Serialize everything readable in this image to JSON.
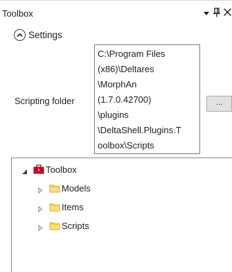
{
  "panel": {
    "title": "Toolbox"
  },
  "settings": {
    "toggle_label": "Settings",
    "scripting_folder_label": "Scripting folder",
    "scripting_folder_lines": [
      "C:\\Program Files",
      "(x86)\\Deltares",
      "\\MorphAn",
      "(1.7.0.42700)",
      "\\plugins",
      "\\DeltaShell.Plugins.T",
      "oolbox\\Scripts"
    ],
    "browse_label": "..."
  },
  "tree": {
    "root": {
      "label": "Toolbox",
      "icon": "toolbox-icon",
      "expanded": true
    },
    "children": [
      {
        "label": "Models",
        "icon": "folder-icon"
      },
      {
        "label": "Items",
        "icon": "folder-icon"
      },
      {
        "label": "Scripts",
        "icon": "folder-icon"
      }
    ]
  },
  "colors": {
    "toolbox_red": "#c8102e",
    "folder_yellow": "#f4c95d"
  }
}
